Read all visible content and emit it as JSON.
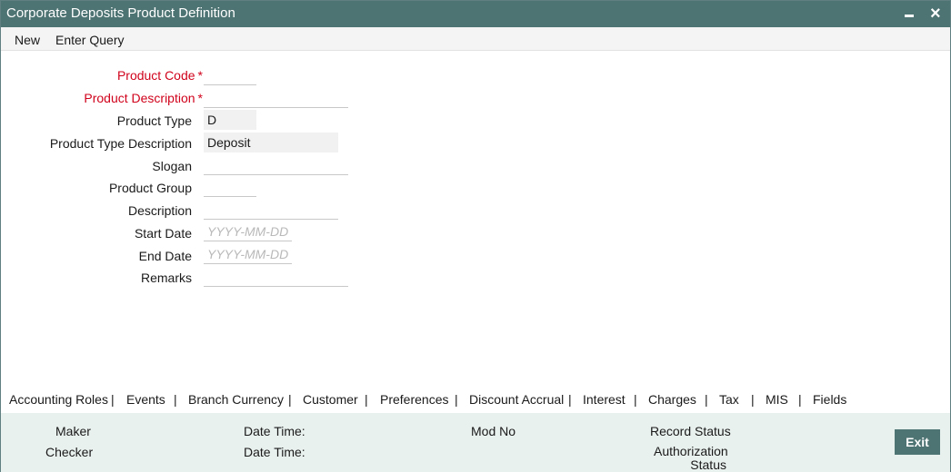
{
  "window": {
    "title": "Corporate Deposits Product Definition",
    "minimize_icon": "minimize-icon",
    "close_icon": "close-icon",
    "close_glyph": "×"
  },
  "menu": {
    "new_label": "New",
    "enter_query_label": "Enter Query"
  },
  "form": {
    "product_code_label": "Product Code",
    "product_description_label": "Product Description",
    "product_type_label": "Product Type",
    "product_type_value": "D",
    "product_type_description_label": "Product Type Description",
    "product_type_description_value": "Deposit",
    "slogan_label": "Slogan",
    "product_group_label": "Product Group",
    "description_label": "Description",
    "start_date_label": "Start Date",
    "start_date_placeholder": "YYYY-MM-DD",
    "end_date_label": "End Date",
    "end_date_placeholder": "YYYY-MM-DD",
    "remarks_label": "Remarks",
    "required_mark": "*"
  },
  "tabs": [
    "Accounting Roles",
    "Events",
    "Branch Currency",
    "Customer",
    "Preferences",
    "Discount Accrual",
    "Interest",
    "Charges",
    "Tax",
    "MIS",
    "Fields"
  ],
  "tab_separator": "|",
  "footer": {
    "maker_label": "Maker",
    "checker_label": "Checker",
    "date_time_label_1": "Date Time:",
    "date_time_label_2": "Date Time:",
    "mod_no_label": "Mod No",
    "record_status_label": "Record Status",
    "authorization_status_label": "Authorization Status",
    "exit_label": "Exit"
  },
  "colors": {
    "titlebar": "#4e7373",
    "required": "#d0021b",
    "footer_bg": "#e9f1ef"
  }
}
